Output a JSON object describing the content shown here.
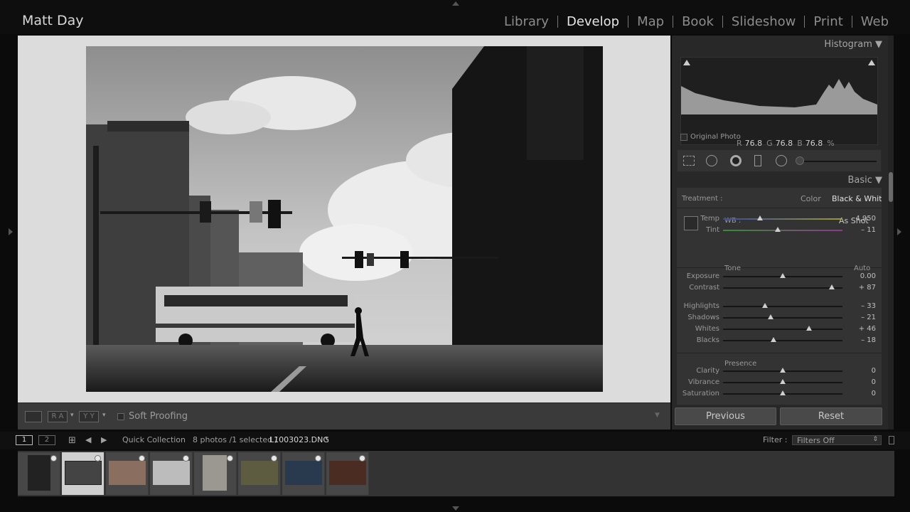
{
  "identity_plate": "Matt Day",
  "modules": [
    {
      "label": "Library",
      "active": false
    },
    {
      "label": "Develop",
      "active": true
    },
    {
      "label": "Map",
      "active": false
    },
    {
      "label": "Book",
      "active": false
    },
    {
      "label": "Slideshow",
      "active": false
    },
    {
      "label": "Print",
      "active": false
    },
    {
      "label": "Web",
      "active": false
    }
  ],
  "toolbar": {
    "view_ra": "R A",
    "view_yy": "Y Y",
    "soft_proofing": "Soft Proofing"
  },
  "histogram": {
    "title": "Histogram",
    "r_label": "R",
    "r_value": "76.8",
    "g_label": "G",
    "g_value": "76.8",
    "b_label": "B",
    "b_value": "76.8",
    "percent": "%",
    "original_photo": "Original Photo"
  },
  "basic": {
    "title": "Basic",
    "treatment_label": "Treatment :",
    "treatment_color": "Color",
    "treatment_bw": "Black & White",
    "wb_label": "WB :",
    "wb_value": "As Shot",
    "tone_label": "Tone",
    "auto_label": "Auto",
    "presence_label": "Presence",
    "sliders": {
      "temp": {
        "label": "Temp",
        "value": "4,950",
        "level": 0.31
      },
      "tint": {
        "label": "Tint",
        "value": "– 11",
        "level": 0.46
      },
      "exposure": {
        "label": "Exposure",
        "value": "0.00",
        "level": 0.5
      },
      "contrast": {
        "label": "Contrast",
        "value": "+ 87",
        "level": 0.91
      },
      "highlights": {
        "label": "Highlights",
        "value": "– 33",
        "level": 0.35
      },
      "shadows": {
        "label": "Shadows",
        "value": "– 21",
        "level": 0.4
      },
      "whites": {
        "label": "Whites",
        "value": "+ 46",
        "level": 0.72
      },
      "blacks": {
        "label": "Blacks",
        "value": "– 18",
        "level": 0.42
      },
      "clarity": {
        "label": "Clarity",
        "value": "0",
        "level": 0.5
      },
      "vibrance": {
        "label": "Vibrance",
        "value": "0",
        "level": 0.5
      },
      "saturation": {
        "label": "Saturation",
        "value": "0",
        "level": 0.5
      }
    }
  },
  "footer": {
    "previous": "Previous",
    "reset": "Reset"
  },
  "filmstrip_bar": {
    "page1": "1",
    "page2": "2",
    "source": "Quick Collection",
    "count": "8 photos /1 selected /",
    "filename": "L1003023.DNG",
    "filter_label": "Filter :",
    "filter_value": "Filters Off"
  },
  "thumbnails": [
    {
      "name": "thumb-1",
      "selected": false
    },
    {
      "name": "thumb-2",
      "selected": true
    },
    {
      "name": "thumb-3",
      "selected": false
    },
    {
      "name": "thumb-4",
      "selected": false
    },
    {
      "name": "thumb-5",
      "selected": false
    },
    {
      "name": "thumb-6",
      "selected": false
    },
    {
      "name": "thumb-7",
      "selected": false
    },
    {
      "name": "thumb-8",
      "selected": false
    }
  ],
  "colors": {
    "active_module": "#e6e6e6",
    "panel_bg": "#333333",
    "viewer_bg": "#dcdcdc"
  }
}
